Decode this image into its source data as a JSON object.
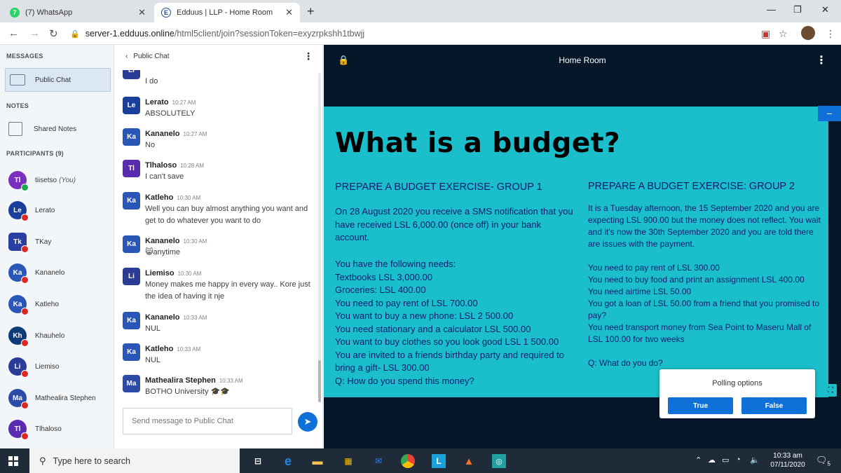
{
  "browser": {
    "tabs": [
      {
        "title": "(7) WhatsApp",
        "favicon": "whatsapp-icon"
      },
      {
        "title": "Edduus | LLP - Home Room",
        "favicon": "edduus-icon"
      }
    ],
    "url_host": "server-1.edduus.online",
    "url_path": "/html5client/join?sessionToken=exyzrpkshh1tbwjj"
  },
  "sidebar": {
    "messages_title": "MESSAGES",
    "public_chat_label": "Public Chat",
    "notes_title": "NOTES",
    "shared_notes_label": "Shared Notes",
    "participants_title": "PARTICIPANTS (9)",
    "you_label": "(You)",
    "participants": [
      {
        "initials": "Tl",
        "name": "tiisetso",
        "color": "#7b2fbe",
        "you": true
      },
      {
        "initials": "Le",
        "name": "Lerato",
        "color": "#1a3e9c"
      },
      {
        "initials": "Tk",
        "name": "TKay",
        "color": "#2a3fa3"
      },
      {
        "initials": "Ka",
        "name": "Kananelo",
        "color": "#2a56b8"
      },
      {
        "initials": "Ka",
        "name": "Katleho",
        "color": "#2a56b8"
      },
      {
        "initials": "Kh",
        "name": "Khauhelo",
        "color": "#0d3a78"
      },
      {
        "initials": "Li",
        "name": "Liemiso",
        "color": "#2b3c98"
      },
      {
        "initials": "Ma",
        "name": "Mathealira Stephen",
        "color": "#2c4aa8"
      },
      {
        "initials": "Tl",
        "name": "Tlhaloso",
        "color": "#5a2ab0"
      }
    ]
  },
  "chat": {
    "title": "Public Chat",
    "input_placeholder": "Send message to Public Chat",
    "messages": [
      {
        "initials": "Li",
        "name": "",
        "time": "",
        "text": "I do",
        "color": "#2b3c98"
      },
      {
        "initials": "Le",
        "name": "Lerato",
        "time": "10:27 AM",
        "text": "ABSOLUTELY",
        "color": "#1a3e9c"
      },
      {
        "initials": "Ka",
        "name": "Kananelo",
        "time": "10:27 AM",
        "text": "No",
        "color": "#2a56b8"
      },
      {
        "initials": "Tl",
        "name": "Tlhaloso",
        "time": "10:28 AM",
        "text": "I can't save",
        "color": "#5a2ab0"
      },
      {
        "initials": "Ka",
        "name": "Katleho",
        "time": "10:30 AM",
        "text": "Well you can buy almost anything you want and get to do whatever you want to do",
        "color": "#2a56b8"
      },
      {
        "initials": "Ka",
        "name": "Kananelo",
        "time": "10:30 AM",
        "text": "😸anytime",
        "color": "#2a56b8"
      },
      {
        "initials": "Li",
        "name": "Liemiso",
        "time": "10:30 AM",
        "text": "Money makes me happy in every way.. Kore just the idea of having it nje",
        "color": "#2b3c98"
      },
      {
        "initials": "Ka",
        "name": "Kananelo",
        "time": "10:33 AM",
        "text": "NUL",
        "color": "#2a56b8"
      },
      {
        "initials": "Ka",
        "name": "Katleho",
        "time": "10:33 AM",
        "text": "NUL",
        "color": "#2a56b8"
      },
      {
        "initials": "Ma",
        "name": "Mathealira Stephen",
        "time": "10:33 AM",
        "text": "BOTHO University 🎓🎓",
        "color": "#2c4aa8"
      }
    ]
  },
  "presentation": {
    "room_title": "Home Room",
    "slide_title": "What is a budget?",
    "group1_heading": "PREPARE A BUDGET EXERCISE- GROUP 1",
    "group1_intro": "On 28 August 2020 you receive a SMS notification that you have received LSL 6,000.00 (once off) in your bank account.",
    "group1_needs": [
      "You have the following needs:",
      "Textbooks LSL 3,000.00",
      "Groceries: LSL 400.00",
      "You need to pay rent of LSL 700.00",
      "You want to buy a new phone: LSL 2 500.00",
      "You need stationary and a calculator LSL 500.00",
      "You want to buy clothes so you look good LSL 1 500.00",
      "You are invited to a friends birthday party and  required to bring a gift- LSL 300.00",
      "Q: How do you spend this money?"
    ],
    "group2_heading": "PREPARE A BUDGET EXERCISE: GROUP 2",
    "group2_intro": "It is a Tuesday afternoon, the 15 September 2020 and you are expecting LSL 900.00 but the money does not reflect. You wait and it's now the 30th September 2020 and you are told there are issues with the payment.",
    "group2_needs": [
      "You need to pay rent of LSL 300.00",
      "You need to buy food and print an assignment LSL 400.00",
      "You need airtime LSL 50.00",
      "You got a loan of LSL 50.00 from a friend that you promised to pay?",
      "You need transport money from Sea Point to Maseru Mall of LSL 100.00 for two weeks"
    ],
    "group2_question": "Q: What do you do?",
    "poll_title": "Polling options",
    "poll_true": "True",
    "poll_false": "False"
  },
  "taskbar": {
    "search_placeholder": "Type here to search",
    "time": "10:33 am",
    "date": "07/11/2020",
    "notif_count": "5"
  },
  "colors": {
    "accent": "#0f70d7",
    "slide_bg": "#1bbfcb",
    "pres_bg": "#06172a"
  }
}
